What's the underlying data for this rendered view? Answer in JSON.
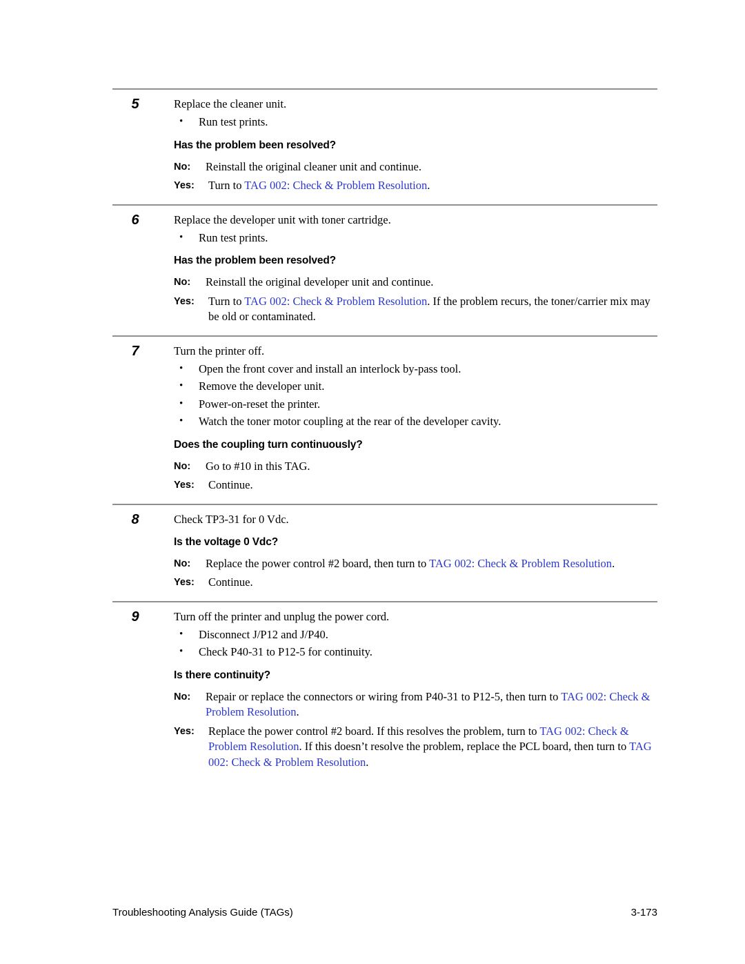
{
  "document": {
    "footer_left": "Troubleshooting Analysis Guide (TAGs)",
    "footer_right": "3-173",
    "link_color": "#2b38cf",
    "rule_color": "#8f8f8f"
  },
  "steps": [
    {
      "number": "5",
      "lead": "Replace the cleaner unit.",
      "bullet_glyph": "•",
      "bullets": [
        "Run test prints."
      ],
      "question": "Has the problem been resolved?",
      "answers": [
        {
          "tag": "No:",
          "parts": [
            {
              "text": "Reinstall the original cleaner unit and continue.",
              "link": false
            }
          ]
        },
        {
          "tag": "Yes:",
          "parts": [
            {
              "text": "Turn to ",
              "link": false
            },
            {
              "text": "TAG 002: Check & Problem Resolution",
              "link": true
            },
            {
              "text": ".",
              "link": false
            }
          ]
        }
      ]
    },
    {
      "number": "6",
      "lead": "Replace the developer unit with toner cartridge.",
      "bullet_glyph": "•",
      "bullets": [
        "Run test prints."
      ],
      "question": "Has the problem been resolved?",
      "answers": [
        {
          "tag": "No:",
          "parts": [
            {
              "text": "Reinstall the original developer unit and continue.",
              "link": false
            }
          ]
        },
        {
          "tag": "Yes:",
          "parts": [
            {
              "text": "Turn to ",
              "link": false
            },
            {
              "text": "TAG 002: Check & Problem Resolution",
              "link": true
            },
            {
              "text": ". If the problem recurs, the toner/carrier mix may be old or contaminated.",
              "link": false
            }
          ]
        }
      ]
    },
    {
      "number": "7",
      "lead": "Turn the printer off.",
      "bullet_glyph": "•",
      "bullets": [
        "Open the front cover and install an interlock by-pass tool.",
        "Remove the developer unit.",
        "Power-on-reset the printer.",
        "Watch the toner motor coupling at the rear of the developer cavity."
      ],
      "question": "Does the coupling turn continuously?",
      "answers": [
        {
          "tag": "No:",
          "parts": [
            {
              "text": "Go to #10 in this TAG.",
              "link": false
            }
          ]
        },
        {
          "tag": "Yes:",
          "parts": [
            {
              "text": "Continue.",
              "link": false
            }
          ]
        }
      ]
    },
    {
      "number": "8",
      "lead": "Check TP3-31 for 0 Vdc.",
      "bullet_glyph": "•",
      "bullets": [],
      "question": "Is the voltage 0 Vdc?",
      "answers": [
        {
          "tag": "No:",
          "parts": [
            {
              "text": "Replace the power control #2 board, then turn to ",
              "link": false
            },
            {
              "text": "TAG 002: Check & Problem Resolution",
              "link": true
            },
            {
              "text": ".",
              "link": false
            }
          ]
        },
        {
          "tag": "Yes:",
          "parts": [
            {
              "text": "Continue.",
              "link": false
            }
          ]
        }
      ]
    },
    {
      "number": "9",
      "lead": "Turn off the printer and unplug the power cord.",
      "bullet_glyph": "•",
      "bullets": [
        "Disconnect J/P12 and J/P40.",
        "Check P40-31 to P12-5 for continuity."
      ],
      "question": "Is there continuity?",
      "answers": [
        {
          "tag": "No:",
          "parts": [
            {
              "text": "Repair or replace the connectors or wiring from P40-31 to P12-5, then turn to ",
              "link": false
            },
            {
              "text": "TAG 002: Check & Problem Resolution",
              "link": true
            },
            {
              "text": ".",
              "link": false
            }
          ]
        },
        {
          "tag": "Yes:",
          "parts": [
            {
              "text": "Replace the power control #2 board. If this resolves the problem, turn to ",
              "link": false
            },
            {
              "text": "TAG 002: Check & Problem Resolution",
              "link": true
            },
            {
              "text": ". If this doesn’t resolve the problem, replace the PCL board, then turn to ",
              "link": false
            },
            {
              "text": "TAG 002: Check & Problem Resolution",
              "link": true
            },
            {
              "text": ".",
              "link": false
            }
          ]
        }
      ]
    }
  ]
}
